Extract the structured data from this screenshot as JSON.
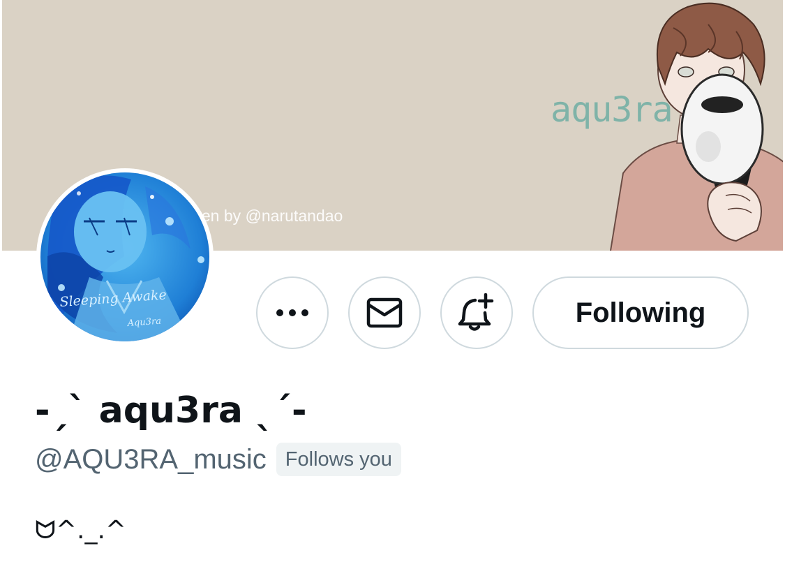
{
  "banner": {
    "logo_text": "aqu3ra",
    "credit_text": "itten by @narutandao",
    "background_color": "#dad2c5",
    "logo_color": "#7fb3a8"
  },
  "avatar": {
    "caption_line1": "Sleeping Awake",
    "caption_line2": "Aqu3ra"
  },
  "actions": {
    "more_icon": "more-dots-icon",
    "message_icon": "envelope-icon",
    "notify_icon": "bell-plus-icon",
    "follow_label": "Following"
  },
  "profile": {
    "display_name": "-ˏˋ aqu3ra ˎˊ-",
    "handle": "@AQU3RA_music",
    "follows_you_label": "Follows you",
    "bio": "ᗢ^._.^"
  },
  "colors": {
    "text_primary": "#0f1419",
    "text_secondary": "#536471",
    "border": "#cfd9de",
    "badge_bg": "#eff3f4"
  }
}
